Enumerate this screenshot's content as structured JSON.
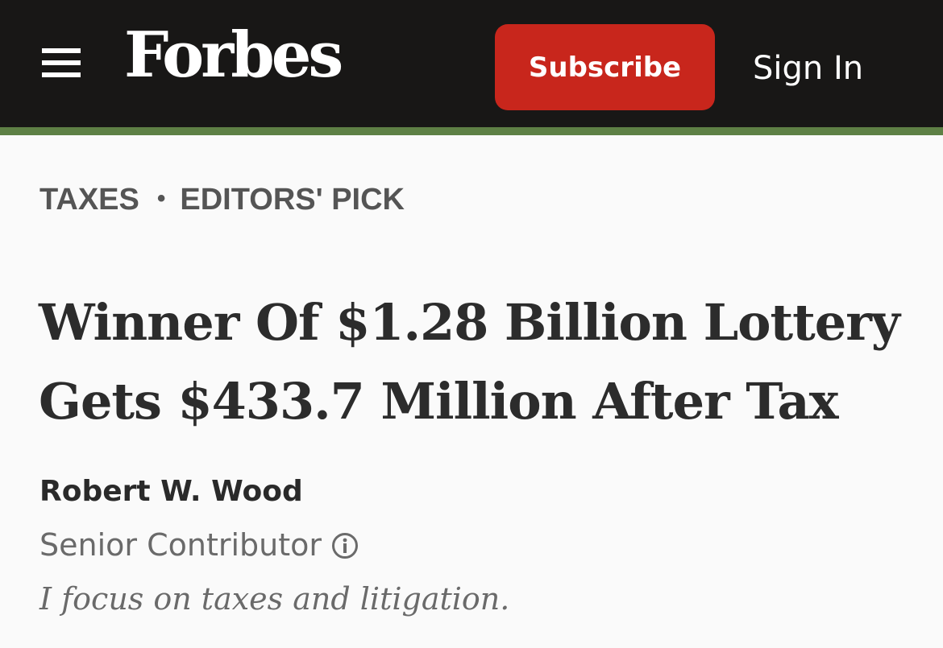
{
  "header": {
    "logo_text": "Forbes",
    "menu_icon": "hamburger-menu-icon",
    "subscribe_label": "Subscribe",
    "signin_label": "Sign In",
    "colors": {
      "bar": "#181716",
      "accent_line": "#5e8045",
      "subscribe_bg": "#c8261c"
    }
  },
  "article": {
    "categories": [
      "TAXES",
      "EDITORS' PICK"
    ],
    "separator": "•",
    "headline": "Winner Of $1.28 Billion Lottery Gets $433.7 Million After Tax",
    "author": {
      "name": "Robert W. Wood",
      "role": "Senior Contributor",
      "role_icon": "info-icon",
      "bio": "I focus on taxes and litigation."
    }
  }
}
